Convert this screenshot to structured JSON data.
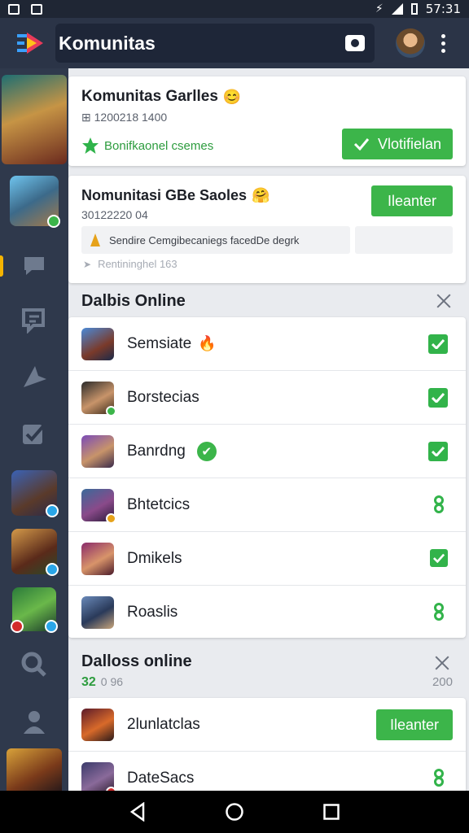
{
  "statusbar": {
    "time": "57:31"
  },
  "appbar": {
    "title": "Komunitas"
  },
  "cards": {
    "first": {
      "title": "Komunitas Garlles",
      "emoji": "😊",
      "meta": "⊞ 1200218 1400",
      "feature": "Bonifkaonel csemes",
      "button": "Vlotifielan"
    },
    "second": {
      "title": "Nomunitasi GBe Saoles",
      "emoji": "🤗",
      "meta": "30122220 04",
      "button": "Ileanter",
      "desc": "Sendire Cemgibecaniegs facedDe degrk",
      "hint": "Rentininghel 163"
    }
  },
  "online": {
    "title": "Dalbis Online",
    "rows": [
      {
        "name": "Semsiate",
        "end": "check",
        "emoji": "🔥"
      },
      {
        "name": "Borstecias",
        "end": "check"
      },
      {
        "name": "Banrdng",
        "end": "check",
        "emoji": "✔"
      },
      {
        "name": "Bhtetcics",
        "end": "ring"
      },
      {
        "name": "Dmikels",
        "end": "check"
      },
      {
        "name": "Roaslis",
        "end": "ring"
      }
    ]
  },
  "online2": {
    "title": "Dalloss online",
    "count": "32",
    "meta": "0 96",
    "right_value": "200",
    "rows": [
      {
        "name": "2lunlatclas",
        "button": "Ileanter"
      },
      {
        "name": "DateSacs"
      }
    ]
  },
  "colors": {
    "accent": "#3cb54a",
    "appbar": "#2b3447",
    "sidebar": "#2f394c"
  }
}
